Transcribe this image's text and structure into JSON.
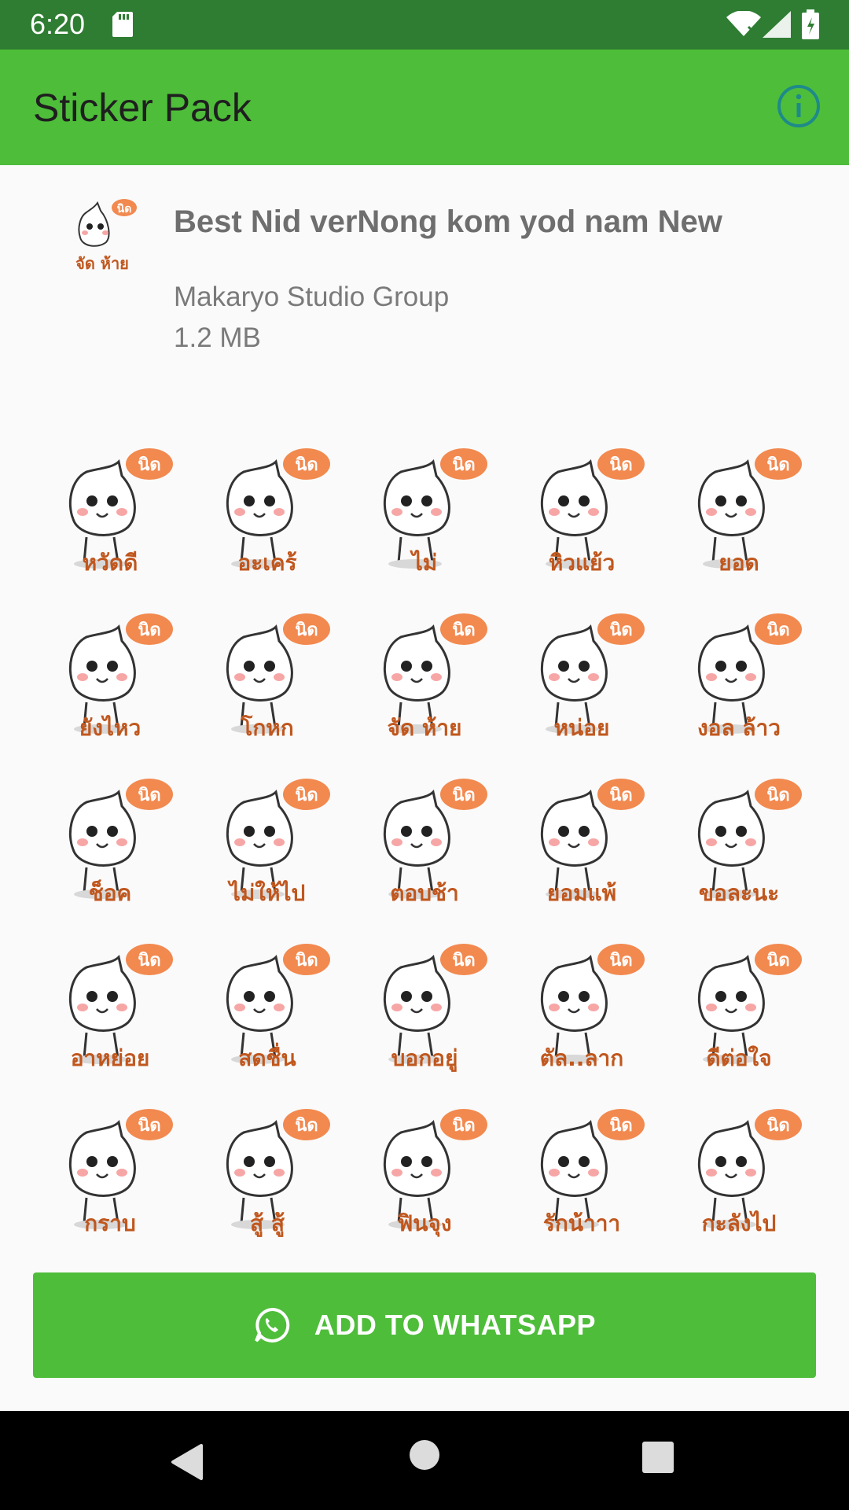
{
  "status_bar": {
    "time": "6:20"
  },
  "app_bar": {
    "title": "Sticker Pack"
  },
  "pack": {
    "name": "Best Nid verNong kom yod nam New",
    "publisher": "Makaryo Studio Group",
    "size": "1.2 MB",
    "tray_badge": "นิด",
    "tray_caption": "จัด ห้าย"
  },
  "stickers": [
    {
      "badge": "นิด",
      "caption": "หวัดดี"
    },
    {
      "badge": "นิด",
      "caption": "อะเคร้"
    },
    {
      "badge": "นิด",
      "caption": "ไม่"
    },
    {
      "badge": "นิด",
      "caption": "หิวแย้ว"
    },
    {
      "badge": "นิด",
      "caption": "ยอด"
    },
    {
      "badge": "นิด",
      "caption": "ยังไหว"
    },
    {
      "badge": "นิด",
      "caption": "โกหก"
    },
    {
      "badge": "นิด",
      "caption": "จัด ห้าย"
    },
    {
      "badge": "นิด",
      "caption": "หน่อย"
    },
    {
      "badge": "นิด",
      "caption": "งอล ล้าว"
    },
    {
      "badge": "นิด",
      "caption": "ช็อค"
    },
    {
      "badge": "นิด",
      "caption": "ไม่ให้ไป"
    },
    {
      "badge": "นิด",
      "caption": "ตอบช้า"
    },
    {
      "badge": "นิด",
      "caption": "ยอมแพ้"
    },
    {
      "badge": "นิด",
      "caption": "ขอละนะ"
    },
    {
      "badge": "นิด",
      "caption": "อาหย่อย"
    },
    {
      "badge": "นิด",
      "caption": "สดชื่น"
    },
    {
      "badge": "นิด",
      "caption": "บอกอยู่"
    },
    {
      "badge": "นิด",
      "caption": "ตัล..ลาก"
    },
    {
      "badge": "นิด",
      "caption": "ดีต่อใจ"
    },
    {
      "badge": "นิด",
      "caption": "กราบ"
    },
    {
      "badge": "นิด",
      "caption": "สู้ สู้"
    },
    {
      "badge": "นิด",
      "caption": "ฟินจุง"
    },
    {
      "badge": "นิด",
      "caption": "รักน้าาา"
    },
    {
      "badge": "นิด",
      "caption": "กะลังไป"
    }
  ],
  "add_button": {
    "label": "ADD TO WHATSAPP"
  },
  "colors": {
    "accent": "#4ebd3a",
    "status_bar": "#2e7d32",
    "badge": "#f2894f",
    "caption": "#c0571e",
    "info": "#1e8a8a"
  },
  "icons": [
    "sd-card-icon",
    "wifi-icon",
    "signal-icon",
    "battery-icon",
    "info-icon",
    "whatsapp-icon",
    "back-icon",
    "home-icon",
    "recents-icon"
  ]
}
